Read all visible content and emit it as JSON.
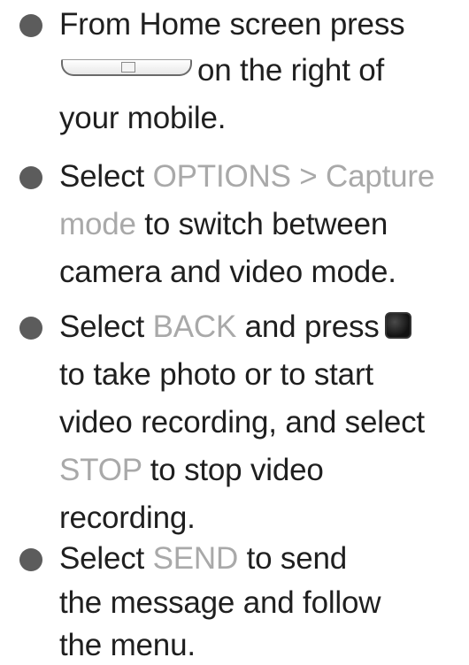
{
  "steps": [
    {
      "line1_text": "From Home screen press",
      "line2_text": "on the right of",
      "line3_text": "your mobile."
    },
    {
      "line1_a": "Select ",
      "line1_hl": "OPTIONS > Capture",
      "line2_hl": "mode",
      "line2_b": " to switch between",
      "line3_text": "camera and video mode."
    },
    {
      "line1_a": "Select ",
      "line1_hl": "BACK",
      "line1_b": " and press",
      "line2_text": "to take photo or to start",
      "line3_text": "video recording, and select",
      "line4_hl": "STOP",
      "line4_b": " to stop video",
      "line5_text": "recording."
    },
    {
      "line1_a": "Select ",
      "line1_hl": "SEND",
      "line1_b": " to send",
      "line2_text": "the message and follow",
      "line3_text": "the menu."
    }
  ],
  "icons": {
    "side_key": "side-key-icon",
    "camera_key": "camera-key-icon"
  },
  "colors": {
    "text": "#1f1f1f",
    "highlight": "#a9a9a9",
    "bullet": "#5c5c5c"
  }
}
